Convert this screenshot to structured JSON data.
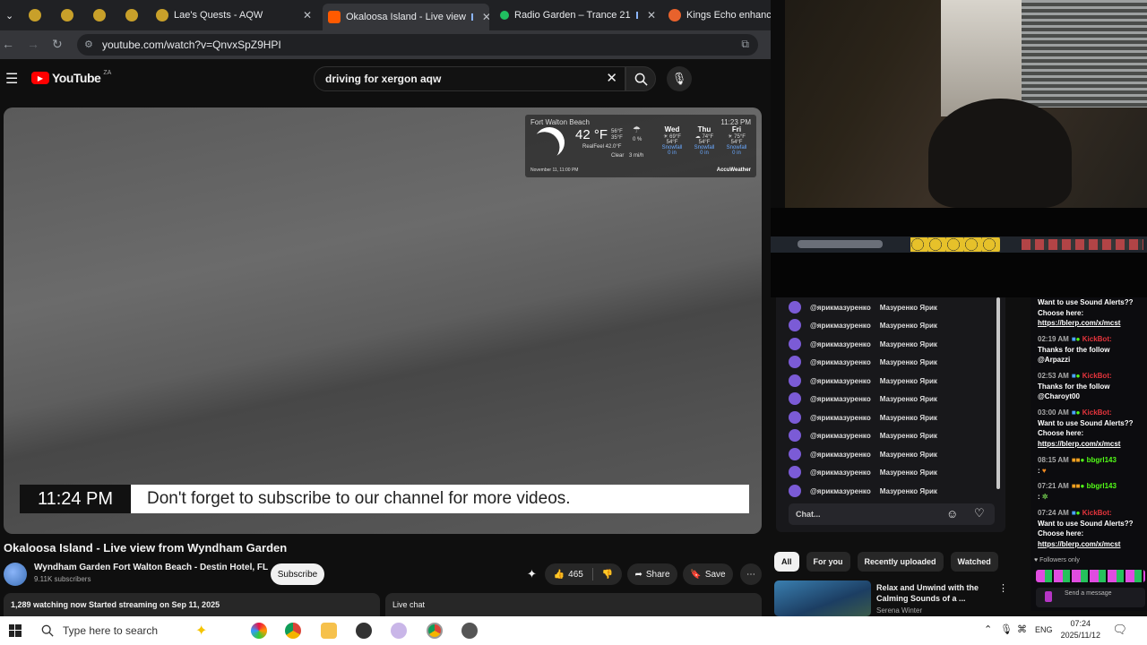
{
  "tabs": [
    {
      "label": ""
    },
    {
      "label": ""
    },
    {
      "label": ""
    },
    {
      "label": ""
    },
    {
      "label": "Lae's Quests - AQW"
    },
    {
      "label": "Okaloosa Island - Live view"
    },
    {
      "label": "Radio Garden – Trance 21"
    },
    {
      "label": "Kings Echo enhancem"
    }
  ],
  "address": {
    "url": "youtube.com/watch?v=QnvxSpZ9HPI"
  },
  "yt": {
    "logo": "YouTube",
    "region": "ZA",
    "search_value": "driving for xergon aqw"
  },
  "weather": {
    "location": "Fort Walton Beach",
    "time": "11:23 PM",
    "temp": "42 °F",
    "hi": "56°F",
    "lo": "35°F",
    "realfeel": "RealFeel 42.0°F",
    "condition": "Clear",
    "precip": "0 %",
    "wind": "3 mi/h",
    "days": [
      {
        "day": "Wed",
        "hi": "69°F",
        "lo": "54°F",
        "snow": "Snowfall",
        "snowval": "0 in"
      },
      {
        "day": "Thu",
        "hi": "74°F",
        "lo": "54°F",
        "snow": "Snowfall",
        "snowval": "0 in"
      },
      {
        "day": "Fri",
        "hi": "75°F",
        "lo": "54°F",
        "snow": "Snowfall",
        "snowval": "0 in"
      }
    ],
    "date": "November 11, 11:00 PM",
    "brand": "AccuWeather"
  },
  "overlay": {
    "clock": "11:24 PM",
    "message": "Don't forget to subscribe to our channel for more videos."
  },
  "video": {
    "title": "Okaloosa Island - Live view from Wyndham Garden",
    "channel": "Wyndham Garden Fort Walton Beach - Destin Hotel, FL",
    "subs": "9.11K subscribers",
    "subscribe": "Subscribe",
    "likes": "465",
    "share": "Share",
    "save": "Save",
    "watching": "1,289 watching now  Started streaming on Sep 11, 2025",
    "livechat": "Live chat"
  },
  "chat1": {
    "rows": [
      {
        "user": "@ярикмазуренко",
        "name": "Мазуренко Ярик"
      },
      {
        "user": "@ярикмазуренко",
        "name": "Мазуренко Ярик"
      },
      {
        "user": "@ярикмазуренко",
        "name": "Мазуренко Ярик"
      },
      {
        "user": "@ярикмазуренко",
        "name": "Мазуренко Ярик"
      },
      {
        "user": "@ярикмазуренко",
        "name": "Мазуренко Ярик"
      },
      {
        "user": "@ярикмазуренко",
        "name": "Мазуренко Ярик"
      },
      {
        "user": "@ярикмазуренко",
        "name": "Мазуренко Ярик"
      },
      {
        "user": "@ярикмазуренко",
        "name": "Мазуренко Ярик"
      },
      {
        "user": "@ярикмазуренко",
        "name": "Мазуренко Ярик"
      },
      {
        "user": "@ярикмазуренко",
        "name": "Мазуренко Ярик"
      },
      {
        "user": "@ярикмазуренко",
        "name": "Мазуренко Ярик"
      }
    ],
    "placeholder": "Chat..."
  },
  "chat2": {
    "top1": "Want to use Sound Alerts??",
    "top2": "Choose here:",
    "top3": "https://blerp.com/x/mcst",
    "m1_time": "02:19 AM",
    "m1_user": "KickBot:",
    "m1_l1": "Thanks for the follow",
    "m1_l2": "@Arpazzi",
    "m2_time": "02:53 AM",
    "m2_user": "KickBot:",
    "m2_l1": "Thanks for the follow",
    "m2_l2": "@Charoyt00",
    "m3_time": "03:00 AM",
    "m3_user": "KickBot:",
    "m3_l1": "Want to use Sound Alerts??",
    "m3_l2": "Choose here:",
    "m3_l3": "https://blerp.com/x/mcst",
    "m4_time": "08:15 AM",
    "m4_user": "bbgrl143",
    "m5_time": "07:21 AM",
    "m5_user": "bbgrl143",
    "m6_time": "07:24 AM",
    "m6_user": "KickBot:",
    "m6_l1": "Want to use Sound Alerts??",
    "m6_l2": "Choose here:",
    "m6_l3": "https://blerp.com/x/mcst",
    "followers": "Followers only",
    "send": "Send a message"
  },
  "chips": [
    "All",
    "For you",
    "Recently uploaded",
    "Watched"
  ],
  "rec": {
    "title1": "Relax and Unwind with the",
    "title2": "Calming Sounds of a ...",
    "author": "Serena Winter"
  },
  "taskbar": {
    "search": "Type here to search",
    "lang": "ENG",
    "time": "07:24",
    "date": "2025/11/12"
  },
  "colors": {
    "yt_red": "#ff0000",
    "kick_green": "#53fc18",
    "chat_purple": "#7b5bd6"
  }
}
